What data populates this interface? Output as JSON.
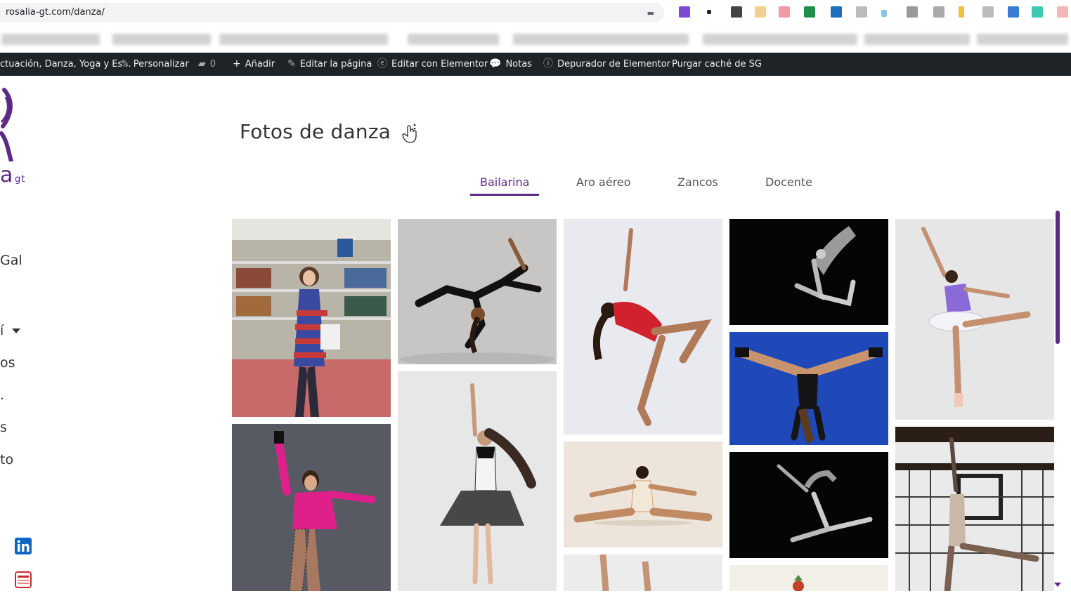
{
  "browser": {
    "url": "rosalia-gt.com/danza/"
  },
  "adminbar": {
    "site": "ctuación, Danza, Yoga y Es...",
    "customize": "Personalizar",
    "comments_count": "0",
    "add_new": "Añadir",
    "edit_page": "Editar la página",
    "edit_elementor": "Editar con Elementor",
    "notes": "Notas",
    "debugger": "Depurador de Elementor",
    "purge_cache": "Purgar caché de SG"
  },
  "sidebar": {
    "logo_text": "a",
    "logo_sub": "gt",
    "nav": [
      "Gal",
      "í",
      "os",
      ".",
      "s",
      "to"
    ]
  },
  "page": {
    "title": "Fotos de danza"
  },
  "tabs": [
    "Bailarina",
    "Aro aéreo",
    "Zancos",
    "Docente"
  ],
  "active_tab": "Bailarina",
  "colors": {
    "accent": "#5b2a86",
    "adminbar": "#1d2327"
  }
}
